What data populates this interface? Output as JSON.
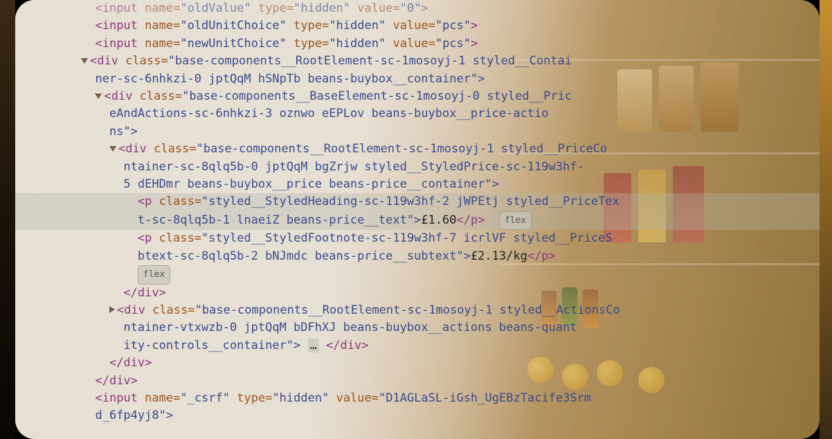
{
  "lines": {
    "l0": "<input name=\"oldValue\" type=\"hidden\" value=\"0\">",
    "l1_a": "<input",
    "l1_name": "name=",
    "l1_nv": "\"oldUnitChoice\"",
    "l1_type": "type=",
    "l1_tv": "\"hidden\"",
    "l1_val": "value=",
    "l1_vv": "\"pcs\"",
    "l1_z": ">",
    "l2_nv": "\"newUnitChoice\"",
    "l3_a": "<div",
    "l3_cls": "class=",
    "l3_cv": "\"base-components__RootElement-sc-1mosoyj-1 styled__Contai",
    "l4": "ner-sc-6nhkzi-0 jptQqM hSNpTb beans-buybox__container\">",
    "l5_cv": "\"base-components__BaseElement-sc-1mosoyj-0 styled__Pric",
    "l6": "eAndActions-sc-6nhkzi-3 oznwo eEPLov beans-buybox__price-actio",
    "l7": "ns\">",
    "l8_cv": "\"base-components__RootElement-sc-1mosoyj-1 styled__PriceCo",
    "l9": "ntainer-sc-8qlq5b-0 jptQqM bgZrjw styled__StyledPrice-sc-119w3hf-",
    "l10": "5 dEHDmr beans-buybox__price beans-price__container\">",
    "l11_a": "<p",
    "l11_cv": "\"styled__StyledHeading-sc-119w3hf-2 jWPEtj styled__PriceTex",
    "l12": "t-sc-8qlq5b-1 lnaeiZ beans-price__text\">",
    "l12_price": "£1.60",
    "l12_z": "</p>",
    "l13_cv": "\"styled__StyledFootnote-sc-119w3hf-7 icrlVF styled__PriceS",
    "l14": "btext-sc-8qlq5b-2 bNJmdc beans-price__subtext\">",
    "l14_price": "£2.13/kg",
    "l14_z": "</p>",
    "badge_flex": "flex",
    "l16": "</div>",
    "l17_cv": "\"base-components__RootElement-sc-1mosoyj-1 styled__ActionsCo",
    "l18": "ntainer-vtxwzb-0 jptQqM bDFhXJ beans-buybox__actions beans-quant",
    "l19": "ity-controls__container\">",
    "l19_ell": "…",
    "l19_z": "</div>",
    "l22_nv": "\"_csrf\"",
    "l22_vv": "\"D1AGLaSL-iGsh_UgEBzTacife3Srm",
    "l23": "d_6fp4yj8\">"
  }
}
